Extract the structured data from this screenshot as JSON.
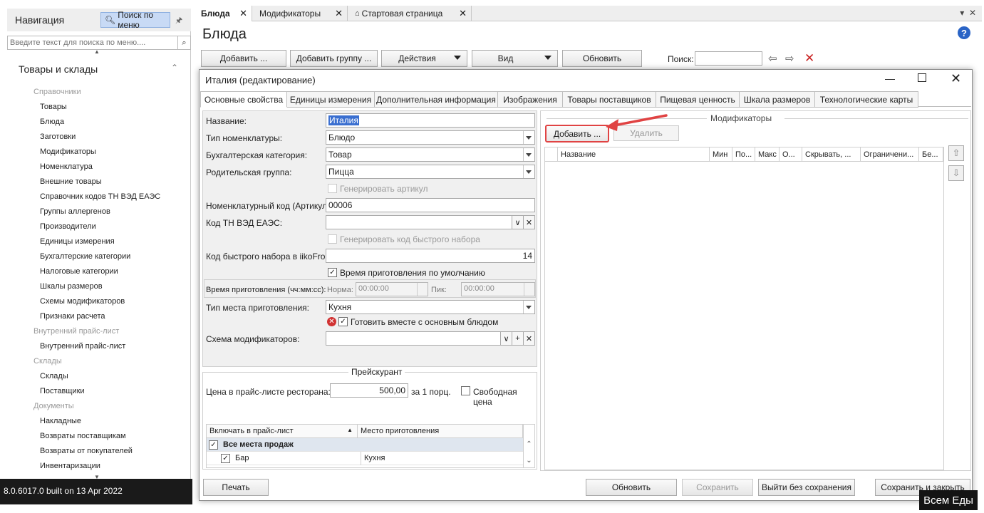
{
  "nav": {
    "title": "Навигация",
    "search_button": "Поиск по меню",
    "search_placeholder": "Введите текст для поиска по меню....",
    "section": "Товары и склады",
    "groups": [
      {
        "cat": "Справочники",
        "items": [
          "Товары",
          "Блюда",
          "Заготовки",
          "Модификаторы",
          "Номенклатура",
          "Внешние товары",
          "Справочник кодов ТН ВЭД ЕАЭС",
          "Группы аллергенов",
          "Производители",
          "Единицы измерения",
          "Бухгалтерские категории",
          "Налоговые категории",
          "Шкалы размеров",
          "Схемы модификаторов",
          "Признаки расчета"
        ]
      },
      {
        "cat": "Внутренний прайс-лист",
        "items": [
          "Внутренний прайс-лист"
        ]
      },
      {
        "cat": "Склады",
        "items": [
          "Склады",
          "Поставщики"
        ]
      },
      {
        "cat": "Документы",
        "items": [
          "Накладные",
          "Возвраты поставщикам",
          "Возвраты от покупателей",
          "Инвентаризации"
        ]
      }
    ],
    "version": "8.0.6017.0 built on 13 Apr 2022"
  },
  "tabs": [
    {
      "label": "Блюда"
    },
    {
      "label": "Модификаторы"
    },
    {
      "label": "Стартовая страница"
    }
  ],
  "page_title": "Блюда",
  "toolbar": {
    "add": "Добавить ...",
    "add_group": "Добавить группу ...",
    "actions": "Действия",
    "view": "Вид",
    "refresh": "Обновить",
    "search_label": "Поиск:"
  },
  "dialog": {
    "title": "Италия (редактирование)",
    "tabs": [
      "Основные свойства",
      "Единицы измерения",
      "Дополнительная информация",
      "Изображения",
      "Товары поставщиков",
      "Пищевая ценность",
      "Шкала размеров",
      "Технологические карты"
    ],
    "fields": {
      "name_label": "Название:",
      "name_value": "Италия",
      "type_label": "Тип номенклатуры:",
      "type_value": "Блюдо",
      "acc_label": "Бухгалтерская категория:",
      "acc_value": "Товар",
      "parent_label": "Родительская группа:",
      "parent_value": "Пицца",
      "gen_article": "Генерировать артикул",
      "article_label": "Номенклатурный код (Артикул):",
      "article_value": "00006",
      "tnved_label": "Код ТН ВЭД ЕАЭС:",
      "gen_quick": "Генерировать код быстрого набора",
      "quick_label": "Код быстрого набора в iikoFront:",
      "quick_value": "14",
      "default_time": "Время приготовления по умолчанию",
      "time_label": "Время приготовления (чч:мм:сс):",
      "norm_label": "Норма:",
      "norm_value": "00:00:00",
      "peak_label": "Пик:",
      "peak_value": "00:00:00",
      "place_label": "Тип места приготовления:",
      "place_value": "Кухня",
      "cook_with_main": "Готовить вместе с основным блюдом",
      "scheme_label": "Схема модификаторов:"
    },
    "price": {
      "title": "Прейскурант",
      "price_label": "Цена в прайс-листе ресторана:",
      "price_value": "500,00",
      "per_portion": "за 1 порц.",
      "free_price": "Свободная цена",
      "col_include": "Включать в прайс-лист",
      "col_place": "Место приготовления",
      "rows": [
        {
          "name": "Все места продаж",
          "place": ""
        },
        {
          "name": "Бар",
          "place": "Кухня"
        }
      ]
    },
    "modifiers": {
      "title": "Модификаторы",
      "add": "Добавить ...",
      "delete": "Удалить",
      "columns": [
        "Название",
        "Мин",
        "По...",
        "Макс",
        "О...",
        "Скрывать, ...",
        "Ограничени...",
        "Бе..."
      ]
    },
    "buttons": {
      "print": "Печать",
      "refresh": "Обновить",
      "save": "Сохранить",
      "exit": "Выйти без сохранения",
      "save_close": "Сохранить и закрыть"
    }
  },
  "watermark": "Всем Еды",
  "colors": {
    "accent_red": "#e04343",
    "nav_search": "#c8daf5",
    "help": "#2a64c6"
  }
}
